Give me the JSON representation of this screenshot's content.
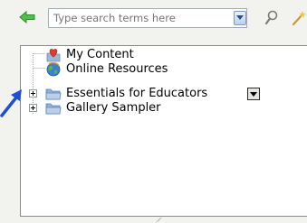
{
  "toolbar": {
    "back_icon": "green-back-arrow-icon",
    "search_placeholder": "Type search terms here",
    "search_value": "",
    "dropdown_icon": "chevron-down-icon",
    "search_icon": "magnifier-icon",
    "tool_icon": "wand-icon"
  },
  "tree": {
    "items": [
      {
        "label": "My Content",
        "icon": "heart-folder-icon",
        "expandable": false,
        "menu": false
      },
      {
        "label": "Online Resources",
        "icon": "globe-icon",
        "expandable": false,
        "menu": false
      },
      {
        "label": "Essentials for Educators",
        "icon": "folder-icon",
        "expandable": true,
        "menu": true
      },
      {
        "label": "Gallery Sampler",
        "icon": "folder-icon",
        "expandable": true,
        "menu": false
      }
    ]
  },
  "colors": {
    "back_arrow": "#3fae3f",
    "pointer_arrow": "#1d4fd8",
    "folder": "#8fb1da"
  }
}
